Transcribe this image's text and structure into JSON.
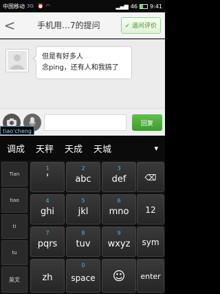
{
  "status": {
    "carrier": "中国移动",
    "network": "3G",
    "signal_strength": "46",
    "time": "9:41",
    "icons": [
      "alarm-icon",
      "wifi-icon",
      "signal-icon",
      "battery-icon"
    ]
  },
  "header": {
    "back_glyph": "<",
    "title": "手机用…7的提问",
    "comment_label": "✓ 追问评价"
  },
  "chat": {
    "message_line1": "但是有好多人",
    "message_line2": "念ping，还有人和我搞了"
  },
  "input": {
    "composing_text": "tiao'cheng",
    "reply_label": "回复"
  },
  "candidates": {
    "items": [
      "调成",
      "天秤",
      "天成",
      "天城"
    ],
    "more_glyph": "▾"
  },
  "keyboard": {
    "left_keys": [
      "Tian",
      "tiao",
      "ti",
      "tu",
      "英文"
    ],
    "keys": [
      {
        "num": "1",
        "label": "'"
      },
      {
        "num": "2",
        "label": "abc"
      },
      {
        "num": "3",
        "label": "def"
      },
      {
        "num": "4",
        "label": "ghi"
      },
      {
        "num": "5",
        "label": "jkl"
      },
      {
        "num": "6",
        "label": "mno"
      },
      {
        "num": "7",
        "label": "pqrs"
      },
      {
        "num": "8",
        "label": "tuv"
      },
      {
        "num": "9",
        "label": "wxyz"
      },
      {
        "num": "",
        "label": "zh"
      },
      {
        "num": "0",
        "label": "space"
      },
      {
        "num": "",
        "label": "☺"
      }
    ],
    "side_keys": [
      "⌫",
      "12",
      "sym",
      "enter"
    ]
  },
  "colors": {
    "accent_green": "#3d9b2c",
    "key_number_blue": "#4bb4e6"
  }
}
